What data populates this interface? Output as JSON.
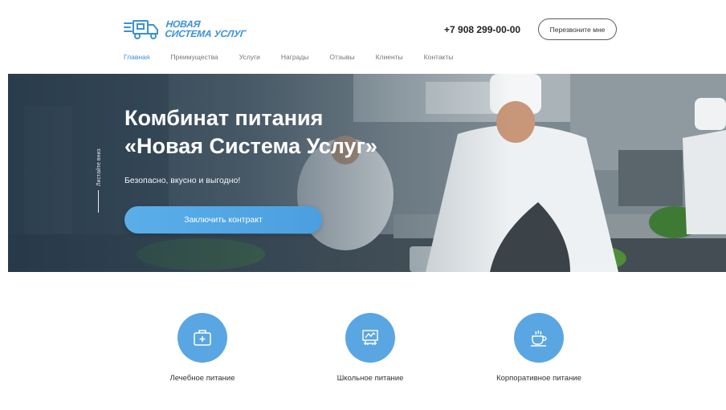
{
  "header": {
    "logo": {
      "line1": "НОВАЯ",
      "line2": "СИСТЕМА УСЛУГ",
      "icon": "delivery-truck-icon"
    },
    "phone": "+7 908 299-00-00",
    "callback_label": "Перезвоните мне"
  },
  "nav": {
    "items": [
      {
        "label": "Главная",
        "active": true
      },
      {
        "label": "Преимущества",
        "active": false
      },
      {
        "label": "Услуги",
        "active": false
      },
      {
        "label": "Награды",
        "active": false
      },
      {
        "label": "Отзывы",
        "active": false
      },
      {
        "label": "Клиенты",
        "active": false
      },
      {
        "label": "Контакты",
        "active": false
      }
    ]
  },
  "hero": {
    "title_line1": "Комбинат питания",
    "title_line2": "«Новая Система Услуг»",
    "subtitle": "Безопасно, вкусно и выгодно!",
    "cta_label": "Заключить контракт",
    "scroll_hint": "Листайте вниз"
  },
  "services": [
    {
      "label": "Лечебное питание",
      "icon": "medical-kit-icon"
    },
    {
      "label": "Школьное питание",
      "icon": "school-board-icon"
    },
    {
      "label": "Корпоративное питание",
      "icon": "coffee-cup-icon"
    }
  ],
  "colors": {
    "accent": "#3a8fd9",
    "button": "#5aaee8",
    "icon_circle": "#5aa6e3"
  }
}
